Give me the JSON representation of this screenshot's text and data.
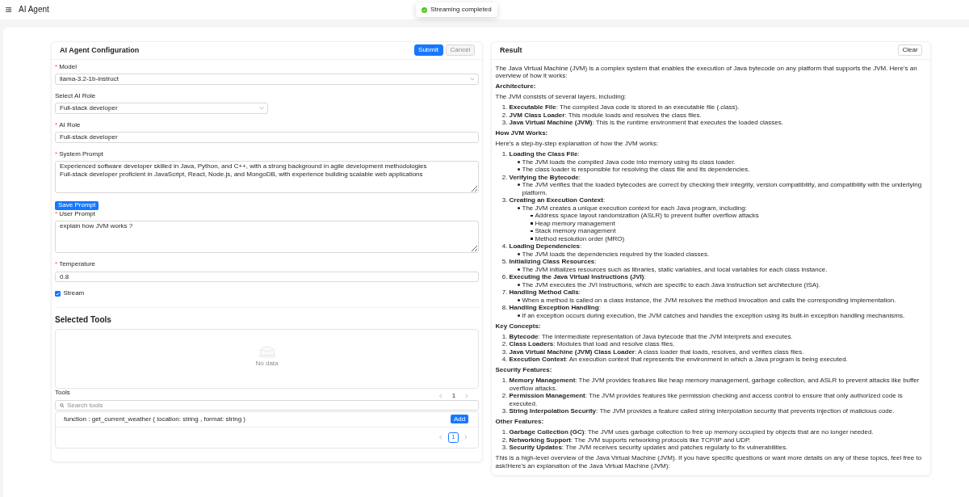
{
  "app_bar": {
    "title": "AI Agent"
  },
  "toast": {
    "kind": "success",
    "message": "Streaming completed"
  },
  "config_panel": {
    "title": "AI Agent Configuration",
    "buttons": [
      {
        "label": "Submit",
        "kind": "primary",
        "disabled": false
      },
      {
        "label": "Cancel",
        "kind": "default",
        "disabled": true
      }
    ],
    "model": {
      "label": "Model",
      "required_mark": "*",
      "value": "llama-3.2-1b-instruct"
    },
    "role_preset": {
      "label": "Select AI Role",
      "value": "Full-stack developer"
    },
    "ai_role": {
      "label": "AI Role",
      "required_mark": "*",
      "value": "Full-stack developer"
    },
    "system_prompt": {
      "label": "System Prompt",
      "required_mark": "*",
      "value": "Experienced software developer skilled in Java, Python, and C++, with a strong background in agile development methodologies\nFull-stack developer proficient in JavaScript, React, Node.js, and MongoDB, with experience building scalable web applications"
    },
    "save_button": {
      "label": "Save Prompt"
    },
    "user_prompt": {
      "label": "User Prompt",
      "required_mark": "*",
      "value": "explain how JVM works ?"
    },
    "temperature": {
      "label": "Temperature",
      "required_mark": "*",
      "value": "0.8"
    },
    "stream": {
      "label": "Stream",
      "checked": true
    },
    "selected_tools": {
      "title": "Selected Tools",
      "empty_text": "No data"
    },
    "tools": {
      "label": "Tools",
      "top_pagination": {
        "current": "1"
      },
      "search": {
        "placeholder": "Search tools"
      },
      "items": [
        {
          "signature": "function : get_current_weather ( location: string , format: string )",
          "button": "Add"
        }
      ],
      "pagination": {
        "pages": [
          {
            "label": "1",
            "selected": true
          }
        ]
      }
    }
  },
  "result_panel": {
    "title": "Result",
    "clear_button": "Clear",
    "content": [
      {
        "kind": "paragraph",
        "text": "The Java Virtual Machine (JVM) is a complex system that enables the execution of Java bytecode on any platform that supports the JVM. Here's an overview of how it works:"
      },
      {
        "kind": "heading",
        "text": "Architecture:"
      },
      {
        "kind": "paragraph",
        "text": "The JVM consists of several layers, including:"
      },
      {
        "kind": "list",
        "items": [
          {
            "marker": "1.",
            "text": "**Executable File**: The compiled Java code is stored in an executable file (.class)."
          },
          {
            "marker": "2.",
            "text": "**JVM Class Loader**: This module loads and resolves the class files."
          },
          {
            "marker": "3.",
            "text": "**Java Virtual Machine (JVM)**: This is the runtime environment that executes the loaded classes."
          }
        ]
      },
      {
        "kind": "heading",
        "text": "How JVM Works:"
      },
      {
        "kind": "paragraph",
        "text": "Here's a step-by-step explanation of how the JVM works:"
      },
      {
        "kind": "list",
        "items": [
          {
            "marker": "1.",
            "text": "**Loading the Class File**:",
            "children": [
              {
                "text": "The JVM loads the compiled Java code into memory using its class loader."
              },
              {
                "text": "The class loader is responsible for resolving the class file and its dependencies."
              }
            ]
          },
          {
            "marker": "2.",
            "text": "**Verifying the Bytecode**:",
            "children": [
              {
                "text": "The JVM verifies that the loaded bytecodes are correct by checking their integrity, version compatibility, and compatibility with the underlying platform."
              }
            ]
          },
          {
            "marker": "3.",
            "text": "**Creating an Execution Context**:",
            "children": [
              {
                "text": "The JVM creates a unique execution context for each Java program, including:",
                "children": [
                  {
                    "text": "Address space layout randomization (ASLR) to prevent buffer overflow attacks"
                  },
                  {
                    "text": "Heap memory management"
                  },
                  {
                    "text": "Stack memory management"
                  },
                  {
                    "text": "Method resolution order (MRO)"
                  }
                ]
              }
            ]
          },
          {
            "marker": "4.",
            "text": "**Loading Dependencies**:",
            "children": [
              {
                "text": "The JVM loads the dependencies required by the loaded classes."
              }
            ]
          },
          {
            "marker": "5.",
            "text": "**Initializing Class Resources**:",
            "children": [
              {
                "text": "The JVM initializes resources such as libraries, static variables, and local variables for each class instance."
              }
            ]
          },
          {
            "marker": "6.",
            "text": "**Executing the Java Virtual Instructions (JVI)**:",
            "children": [
              {
                "text": "The JVM executes the JVI instructions, which are specific to each Java instruction set architecture (ISA)."
              }
            ]
          },
          {
            "marker": "7.",
            "text": "**Handling Method Calls**:",
            "children": [
              {
                "text": "When a method is called on a class instance, the JVM resolves the method invocation and calls the corresponding implementation."
              }
            ]
          },
          {
            "marker": "8.",
            "text": "**Handling Exception Handling**:",
            "children": [
              {
                "text": "If an exception occurs during execution, the JVM catches and handles the exception using its built-in exception handling mechanisms."
              }
            ]
          }
        ]
      },
      {
        "kind": "heading",
        "text": "Key Concepts:"
      },
      {
        "kind": "list",
        "items": [
          {
            "marker": "1.",
            "text": "**Bytecode**: The intermediate representation of Java bytecode that the JVM interprets and executes."
          },
          {
            "marker": "2.",
            "text": "**Class Loaders**: Modules that load and resolve class files."
          },
          {
            "marker": "3.",
            "text": "**Java Virtual Machine (JVM) Class Loader**: A class loader that loads, resolves, and verifies class files."
          },
          {
            "marker": "4.",
            "text": "**Execution Context**: An execution context that represents the environment in which a Java program is being executed."
          }
        ]
      },
      {
        "kind": "heading",
        "text": "Security Features:"
      },
      {
        "kind": "list",
        "items": [
          {
            "marker": "1.",
            "text": "**Memory Management**: The JVM provides features like heap memory management, garbage collection, and ASLR to prevent attacks like buffer overflow attacks."
          },
          {
            "marker": "2.",
            "text": "**Permission Management**: The JVM provides features like permission checking and access control to ensure that only authorized code is executed."
          },
          {
            "marker": "3.",
            "text": "**String Interpolation Security**: The JVM provides a feature called string interpolation security that prevents injection of malicious code."
          }
        ]
      },
      {
        "kind": "heading",
        "text": "Other Features:"
      },
      {
        "kind": "list",
        "items": [
          {
            "marker": "1.",
            "text": "**Garbage Collection (GC)**: The JVM uses garbage collection to free up memory occupied by objects that are no longer needed."
          },
          {
            "marker": "2.",
            "text": "**Networking Support**: The JVM supports networking protocols like TCP/IP and UDP."
          },
          {
            "marker": "3.",
            "text": "**Security Updates**: The JVM receives security updates and patches regularly to fix vulnerabilities."
          }
        ]
      },
      {
        "kind": "paragraph",
        "text": "This is a high-level overview of the Java Virtual Machine (JVM). If you have specific questions or want more details on any of these topics, feel free to ask!Here's an explanation of the Java Virtual Machine (JVM):"
      }
    ]
  }
}
